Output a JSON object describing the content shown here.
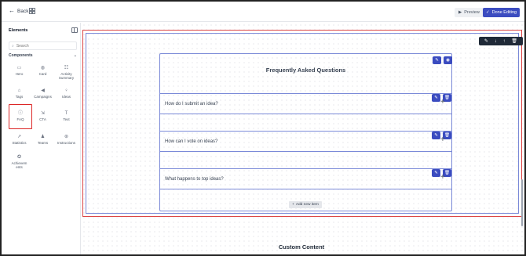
{
  "topbar": {
    "back_label": "Back",
    "preview_label": "Preview",
    "done_label": "Done Editing"
  },
  "sidebar": {
    "title": "Elements",
    "search_placeholder": "Search",
    "section_label": "Components",
    "components": [
      {
        "label": "Hero",
        "icon": "hero-icon"
      },
      {
        "label": "Card",
        "icon": "card-icon"
      },
      {
        "label": "Activity Summary",
        "icon": "activity-summary-icon"
      },
      {
        "label": "Tags",
        "icon": "tag-icon"
      },
      {
        "label": "Campaigns",
        "icon": "megaphone-icon"
      },
      {
        "label": "Ideas",
        "icon": "lightbulb-icon"
      },
      {
        "label": "FAQ",
        "icon": "help-circle-icon",
        "selected": true
      },
      {
        "label": "CTA",
        "icon": "cta-icon"
      },
      {
        "label": "Text",
        "icon": "text-icon"
      },
      {
        "label": "Statistics",
        "icon": "trend-icon"
      },
      {
        "label": "Teams",
        "icon": "users-icon"
      },
      {
        "label": "Instructions",
        "icon": "compass-icon"
      },
      {
        "label": "Achievements",
        "icon": "award-icon"
      }
    ]
  },
  "canvas": {
    "faq": {
      "title": "Frequently Asked Questions",
      "items": [
        {
          "question": "How do I submit an idea?"
        },
        {
          "question": "How can I vote on ideas?"
        },
        {
          "question": "What happens to top ideas?"
        }
      ],
      "add_item_label": "Add new item"
    },
    "next_section_title": "Custom Content"
  },
  "colors": {
    "accent": "#3b4cc0",
    "selection_outline": "#dc4646",
    "section_toolbar": "#1f2937"
  }
}
